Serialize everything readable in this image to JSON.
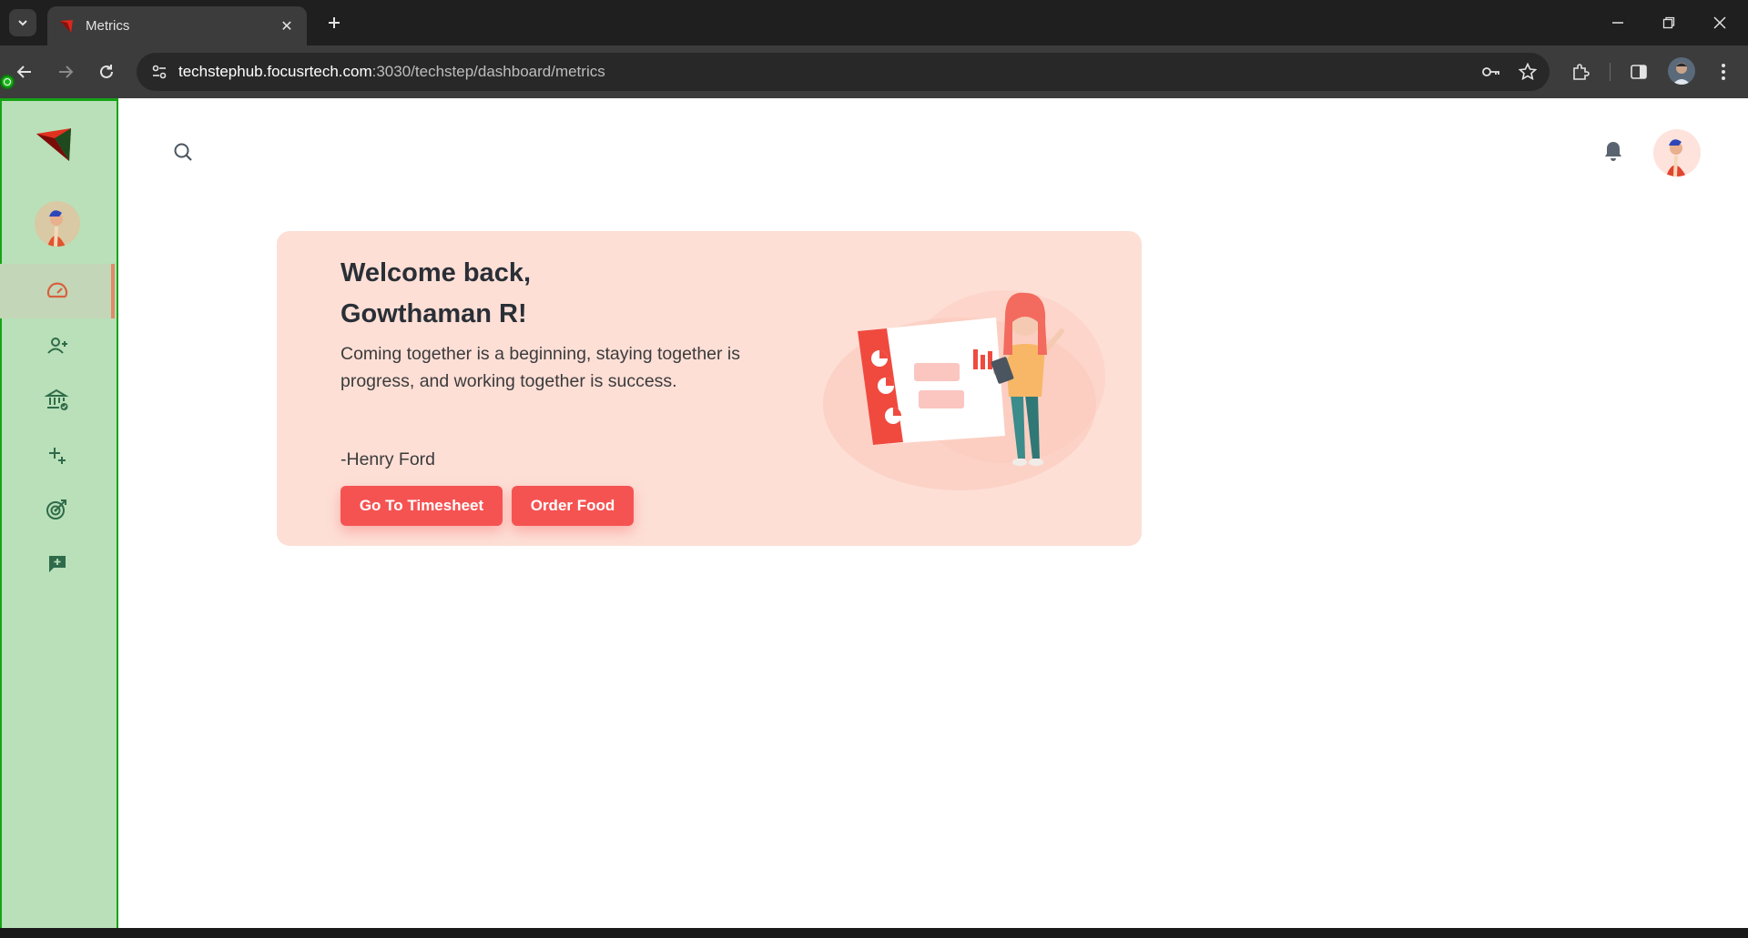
{
  "browser": {
    "tab_title": "Metrics",
    "url_host": "techstephub.focusrtech.com",
    "url_rest": ":3030/techstep/dashboard/metrics",
    "icons": [
      "tab-search-icon",
      "close-icon",
      "plus-icon",
      "minimize-icon",
      "restore-icon",
      "close-window-icon",
      "back-icon",
      "forward-icon",
      "reload-icon",
      "site-settings-icon",
      "key-icon",
      "star-icon",
      "extensions-icon",
      "side-panel-icon",
      "more-icon"
    ]
  },
  "sidebar": {
    "items": [
      {
        "id": "dashboard",
        "icon": "speedometer-icon",
        "active": true
      },
      {
        "id": "add-user",
        "icon": "add-user-icon",
        "active": false
      },
      {
        "id": "bank",
        "icon": "bank-icon",
        "active": false
      },
      {
        "id": "sparkle",
        "icon": "sparkle-icon",
        "active": false
      },
      {
        "id": "target",
        "icon": "target-icon",
        "active": false
      },
      {
        "id": "feedback",
        "icon": "feedback-icon",
        "active": false
      }
    ],
    "colors": {
      "background": "#b9e0b8",
      "accent": "#e08a68",
      "icon": "#2f6b4a"
    }
  },
  "header": {
    "icons": [
      "search-icon",
      "bell-icon"
    ]
  },
  "welcome": {
    "greeting_line1": "Welcome back,",
    "greeting_line2": "Gowthaman R!",
    "quote": "Coming together is a beginning, staying together is progress, and working together is success.",
    "author": "-Henry Ford",
    "timesheet_button": "Go To Timesheet",
    "order_food_button": "Order Food",
    "colors": {
      "card": "#fddfd6",
      "button": "#f55352"
    }
  }
}
